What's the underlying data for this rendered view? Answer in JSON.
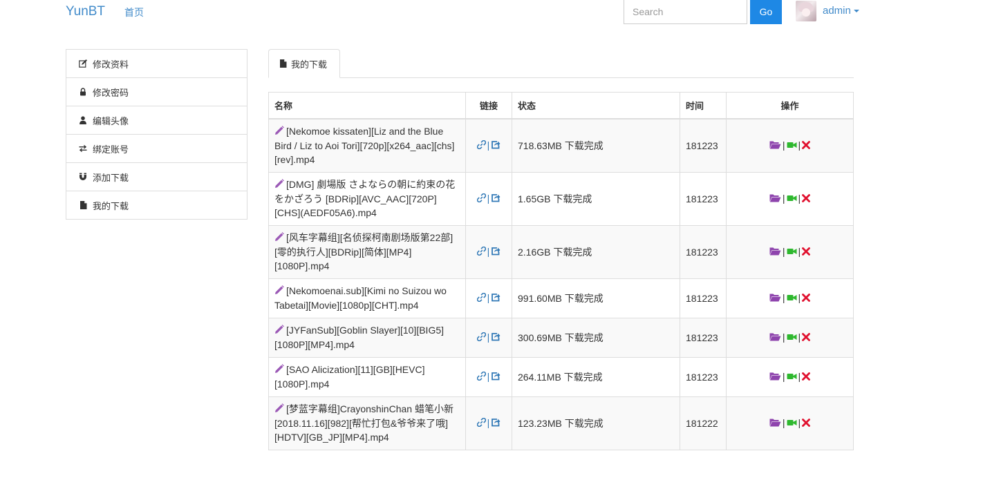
{
  "navbar": {
    "brand": "YunBT",
    "home": "首页",
    "search_placeholder": "Search",
    "go_label": "Go",
    "username": "admin"
  },
  "sidebar": {
    "items": [
      {
        "label": "修改资料",
        "icon": "edit-icon"
      },
      {
        "label": "修改密码",
        "icon": "lock-icon"
      },
      {
        "label": "编辑头像",
        "icon": "user-icon"
      },
      {
        "label": "绑定账号",
        "icon": "transfer-icon"
      },
      {
        "label": "添加下载",
        "icon": "magnet-icon"
      },
      {
        "label": "我的下载",
        "icon": "file-icon"
      }
    ]
  },
  "tab": {
    "label": "我的下载",
    "icon": "file-icon"
  },
  "table": {
    "headers": {
      "name": "名称",
      "link": "链接",
      "status": "状态",
      "time": "时间",
      "op": "操作"
    },
    "link_sep": "|",
    "rows": [
      {
        "name": "[Nekomoe kissaten][Liz and the Blue Bird / Liz to Aoi Tori][720p][x264_aac][chs][rev].mp4",
        "status": "718.63MB 下载完成",
        "time": "181223"
      },
      {
        "name": "[DMG] 劇場版 さよならの朝に約束の花をかざろう [BDRip][AVC_AAC][720P][CHS](AEDF05A6).mp4",
        "status": "1.65GB 下载完成",
        "time": "181223"
      },
      {
        "name": "[风车字幕组][名侦探柯南剧场版第22部][零的执行人][BDRip][简体][MP4][1080P].mp4",
        "status": "2.16GB 下载完成",
        "time": "181223"
      },
      {
        "name": "[Nekomoenai.sub][Kimi no Suizou wo Tabetai][Movie][1080p][CHT].mp4",
        "status": "991.60MB 下载完成",
        "time": "181223"
      },
      {
        "name": "[JYFanSub][Goblin Slayer][10][BIG5][1080P][MP4].mp4",
        "status": "300.69MB 下载完成",
        "time": "181223"
      },
      {
        "name": "[SAO Alicization][11][GB][HEVC][1080P].mp4",
        "status": "264.11MB 下载完成",
        "time": "181223"
      },
      {
        "name": "[梦蓝字幕组]CrayonshinChan 蜡笔小新[2018.11.16][982][帮忙打包&爷爷来了哦][HDTV][GB_JP][MP4].mp4",
        "status": "123.23MB 下载完成",
        "time": "181222"
      }
    ]
  },
  "colors": {
    "link": "#428bca",
    "go": "#1e88e5",
    "edit": "#9b59b6",
    "folder": "#8e44ad",
    "video": "#2eb82e",
    "delete": "#e0102e"
  }
}
